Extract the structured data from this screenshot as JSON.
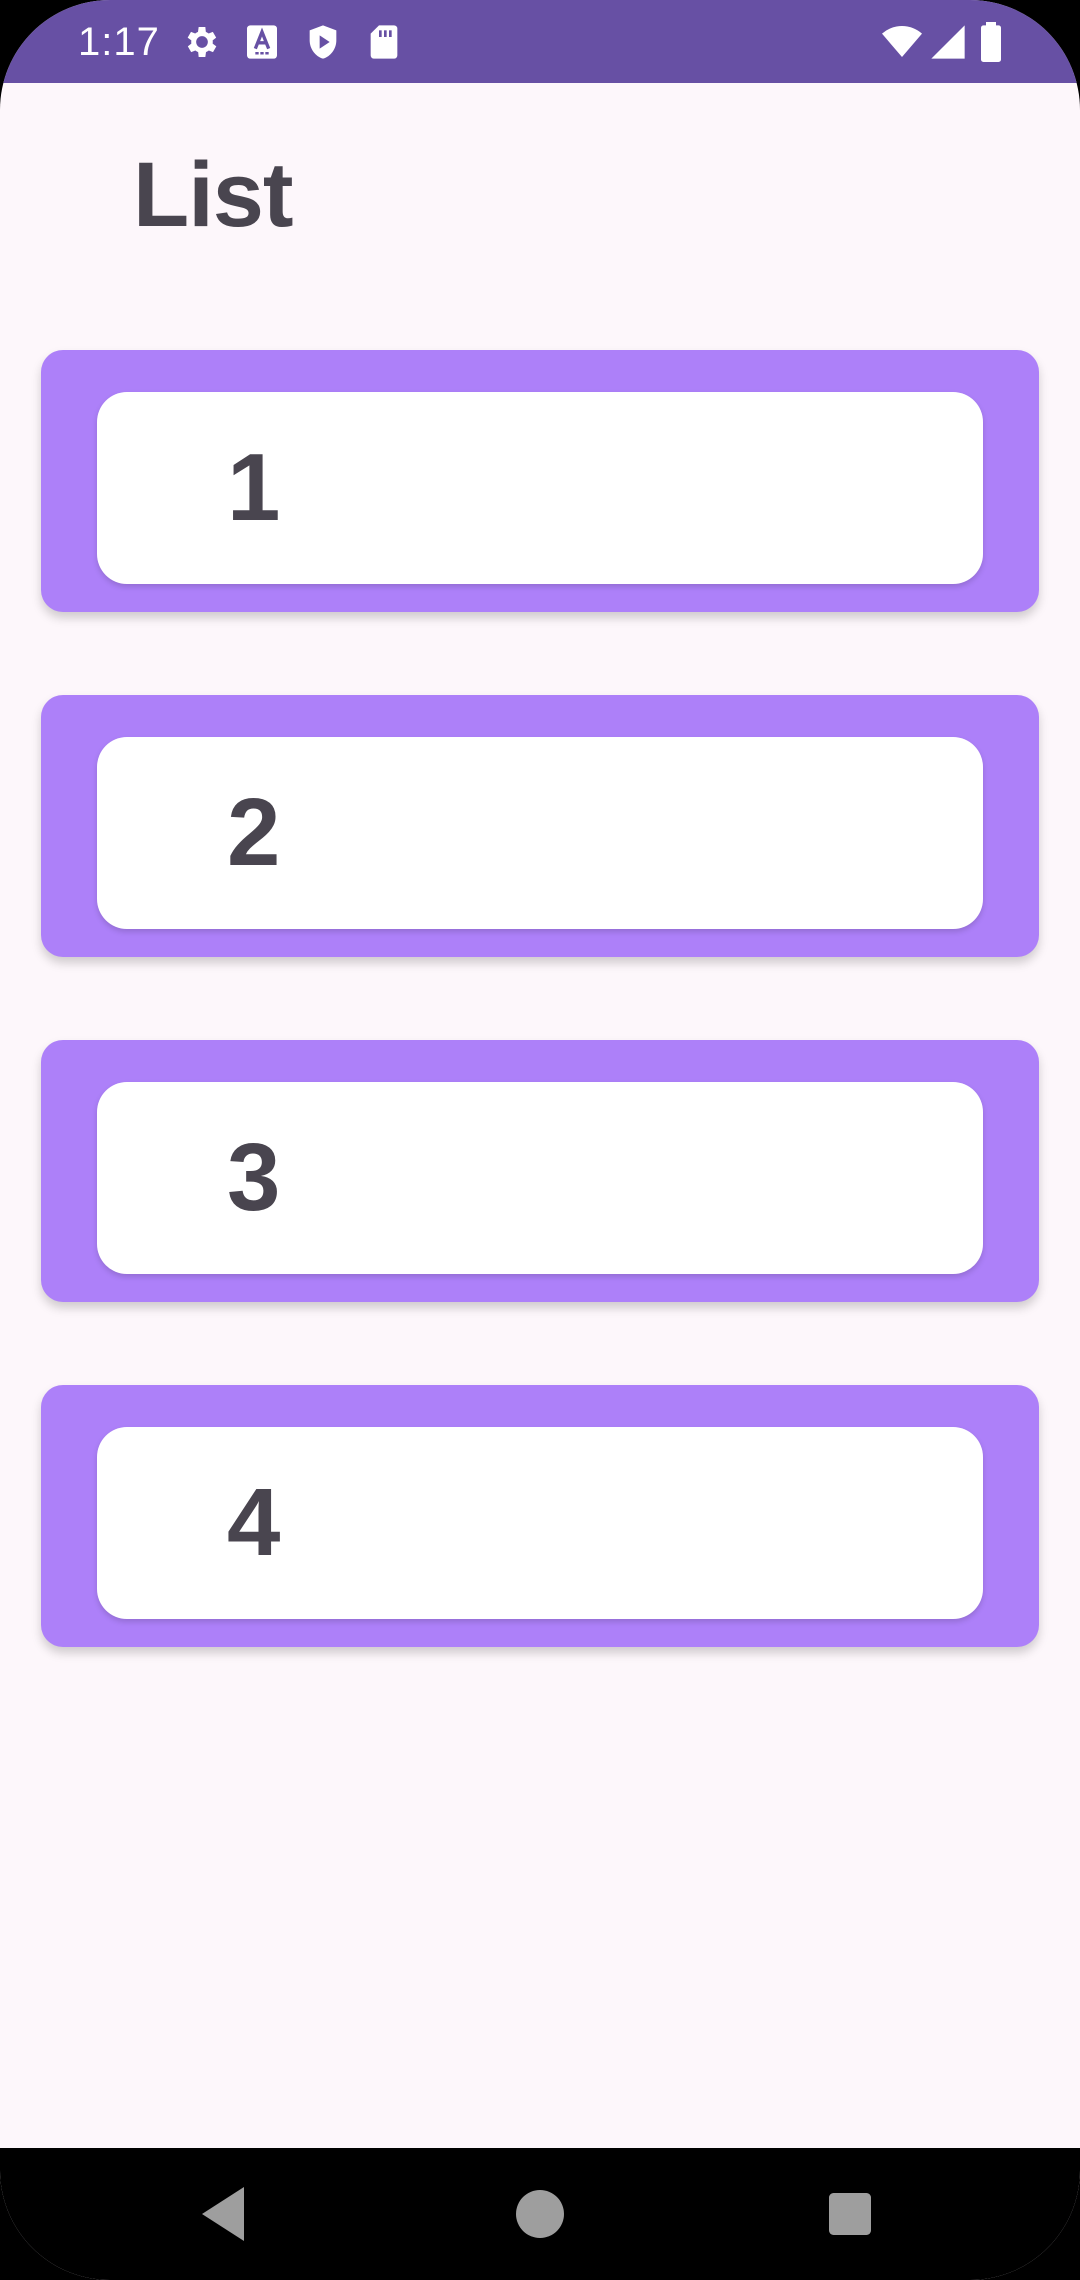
{
  "status_bar": {
    "time": "1:17",
    "left_icons": [
      "gear-icon",
      "text-a-icon",
      "shield-play-icon",
      "sd-card-icon"
    ],
    "right_icons": [
      "wifi-icon",
      "signal-icon",
      "battery-icon"
    ],
    "color": "#6750a4"
  },
  "page": {
    "title": "List"
  },
  "list": {
    "items": [
      {
        "label": "1"
      },
      {
        "label": "2"
      },
      {
        "label": "3"
      },
      {
        "label": "4"
      }
    ],
    "item_color": "#ad80f9",
    "card_color": "#ffffff"
  },
  "nav_bar": {
    "buttons": [
      "back-icon",
      "home-icon",
      "recents-icon"
    ]
  }
}
